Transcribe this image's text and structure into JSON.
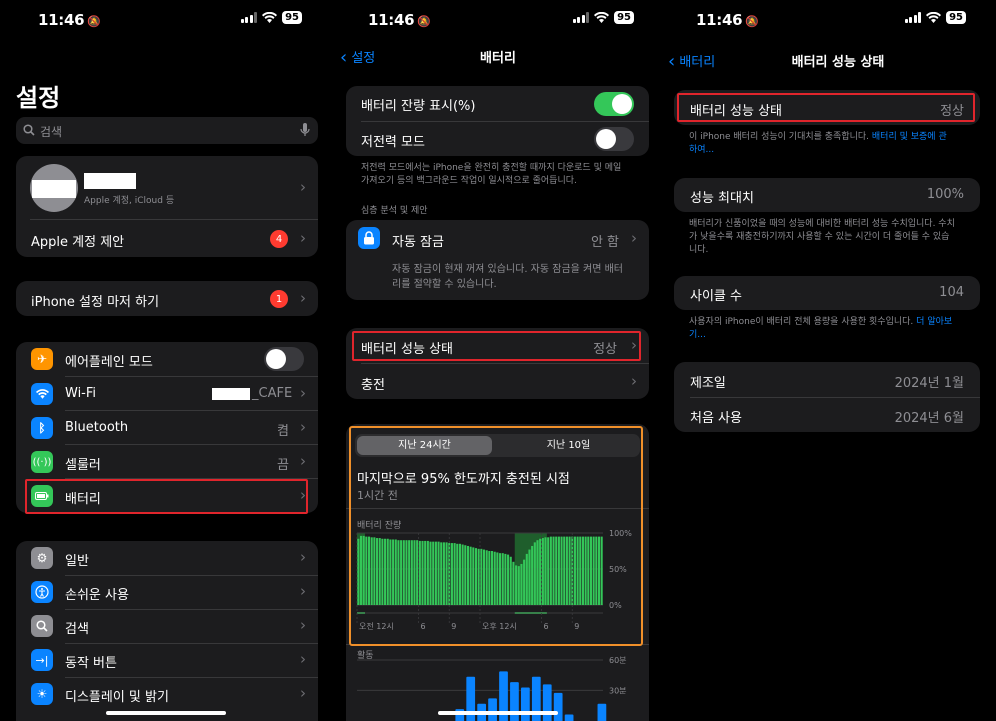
{
  "status": {
    "time": "11:46",
    "battery": "95"
  },
  "settings": {
    "title": "설정",
    "search_placeholder": "검색",
    "account_sub": "Apple 계정, iCloud 등",
    "account_suggest": "Apple 계정 제안",
    "account_badge": "4",
    "finish_setup": "iPhone 설정 마저 하기",
    "finish_badge": "1",
    "airplane": "에어플레인 모드",
    "wifi": "Wi-Fi",
    "wifi_value": "_CAFE",
    "bluetooth": "Bluetooth",
    "bluetooth_value": "켬",
    "cellular": "셀룰러",
    "cellular_value": "끔",
    "battery": "배터리",
    "general": "일반",
    "accessibility": "손쉬운 사용",
    "search": "검색",
    "action_button": "동작 버튼",
    "display": "디스플레이 및 밝기"
  },
  "battery": {
    "back": "설정",
    "title": "배터리",
    "percent_label": "배터리 잔량 표시(%)",
    "low_power": "저전력 모드",
    "low_power_note": "저전력 모드에서는 iPhone을 완전히 충전할 때까지 다운로드 및 메일 가져오기 등의 백그라운드 작업이 일시적으로 줄어듭니다.",
    "section_header": "심층 분석 및 제안",
    "auto_lock": "자동 잠금",
    "auto_lock_value": "안 함",
    "auto_lock_note": "자동 잠금이 현재 꺼져 있습니다. 자동 잠금을 켜면 배터리를 절약할 수 있습니다.",
    "health": "배터리 성능 상태",
    "health_value": "정상",
    "charging": "충전",
    "seg_24h": "지난 24시간",
    "seg_10d": "지난 10일",
    "last_charged": "마지막으로 95% 한도까지 충전된 시점",
    "last_charged_time": "1시간 전",
    "level_label": "배터리 잔량",
    "activity_label": "활동"
  },
  "chart_data": [
    {
      "type": "bar",
      "title": "배터리 잔량",
      "x_ticks": [
        "오전 12시",
        "6",
        "9",
        "오후 12시",
        "6",
        "9"
      ],
      "y_ticks": [
        "100%",
        "50%",
        "0%"
      ],
      "ylim": [
        0,
        100
      ],
      "values": [
        92,
        96,
        96,
        95,
        95,
        94,
        94,
        93,
        93,
        92,
        92,
        92,
        91,
        91,
        91,
        90,
        90,
        90,
        90,
        90,
        90,
        90,
        90,
        89,
        89,
        89,
        89,
        88,
        88,
        88,
        88,
        87,
        87,
        87,
        86,
        86,
        86,
        85,
        85,
        84,
        83,
        82,
        81,
        80,
        79,
        78,
        78,
        77,
        76,
        75,
        75,
        74,
        73,
        72,
        72,
        71,
        70,
        67,
        60,
        55,
        54,
        57,
        63,
        71,
        77,
        82,
        87,
        90,
        92,
        93,
        94,
        94,
        95,
        95,
        95,
        95,
        95,
        95,
        95,
        95,
        95,
        95,
        95,
        95,
        95,
        95,
        95,
        95,
        95,
        95,
        95,
        95
      ],
      "charging_ranges": [
        [
          0,
          2
        ],
        [
          59,
          70
        ]
      ],
      "colors": {
        "level": "#34c759",
        "charging": "#1f5e2c"
      }
    },
    {
      "type": "bar",
      "title": "활동",
      "y_ticks": [
        "60분",
        "30분"
      ],
      "ylim": [
        0,
        60
      ],
      "values": [
        0,
        0,
        0,
        0,
        0,
        0,
        0,
        0,
        0,
        0,
        0,
        0,
        0,
        0,
        0,
        0,
        5,
        0,
        25,
        0,
        55,
        0,
        30,
        0,
        35,
        0,
        60,
        0,
        50,
        0,
        45,
        0,
        55,
        0,
        48,
        0,
        40,
        0,
        20,
        0,
        0,
        0,
        10,
        0,
        30
      ],
      "colors": {
        "bar": "#0a84ff"
      }
    }
  ],
  "health": {
    "back": "배터리",
    "title": "배터리 성능 상태",
    "status_label": "배터리 성능 상태",
    "status_value": "정상",
    "status_note": "이 iPhone 배터리 성능이 기대치를 충족합니다.",
    "status_link": "배터리 및 보증에 관하여...",
    "max_capacity": "성능 최대치",
    "max_capacity_value": "100%",
    "max_note": "배터리가 신품이었을 때의 성능에 대비한 배터리 성능 수치입니다. 수치가 낮을수록 재충전하기까지 사용할 수 있는 시간이 더 줄어들 수 있습니다.",
    "cycle_count": "사이클 수",
    "cycle_count_value": "104",
    "cycle_note": "사용자의 iPhone이 배터리 전체 용량을 사용한 횟수입니다.",
    "cycle_link": "더 알아보기...",
    "manufactured": "제조일",
    "manufactured_value": "2024년 1월",
    "first_use": "처음 사용",
    "first_use_value": "2024년 6월"
  }
}
